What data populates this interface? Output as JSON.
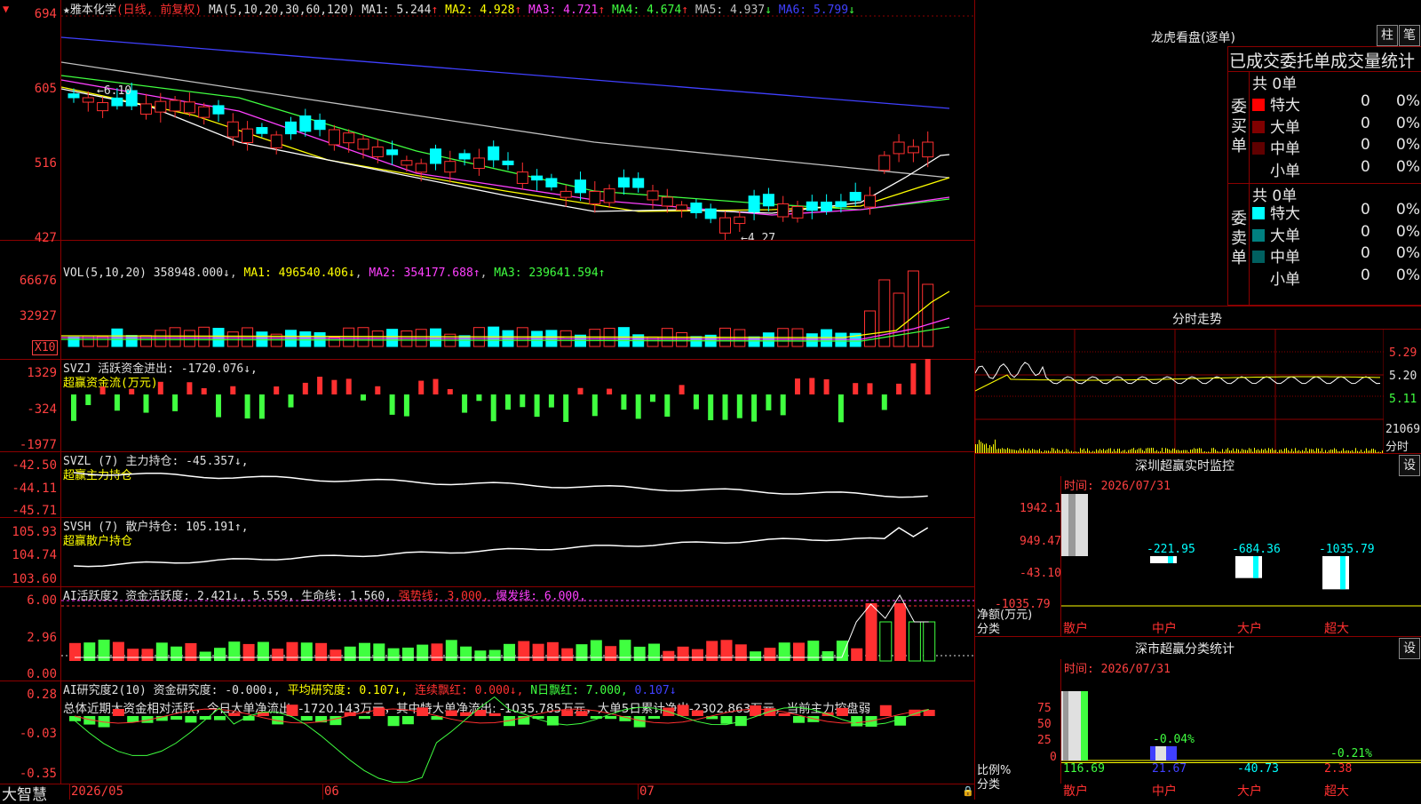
{
  "stock": {
    "star": "★",
    "name": "雅本化学",
    "period": "(日线, 前复权)",
    "ma_label": "MA(5,10,20,30,60,120)",
    "ma_values": [
      {
        "label": "MA1:",
        "value": "5.244",
        "arrow": "↑",
        "color": "#e0e0e0"
      },
      {
        "label": "MA2:",
        "value": "4.928",
        "arrow": "↑",
        "color": "#ffff00"
      },
      {
        "label": "MA3:",
        "value": "4.721",
        "arrow": "↑",
        "color": "#ff40ff"
      },
      {
        "label": "MA4:",
        "value": "4.674",
        "arrow": "↑",
        "color": "#40ff40"
      },
      {
        "label": "MA5:",
        "value": "4.937",
        "arrow": "↓",
        "color": "#c0c0c0"
      },
      {
        "label": "MA6:",
        "value": "5.799",
        "arrow": "↓",
        "color": "#4040ff"
      }
    ],
    "price_axis": [
      "694",
      "605",
      "516",
      "427"
    ],
    "high_mark": "←6.10",
    "low_mark": "←4.27"
  },
  "vol": {
    "title": "VOL(5,10,20)",
    "value": "358948.000↓",
    "ma1": "MA1: 496540.406↓",
    "ma2": "MA2: 354177.688↑",
    "ma3": "MA3: 239641.594↑",
    "axis": [
      "66676",
      "32927"
    ],
    "unit": "X10"
  },
  "svzj": {
    "title": "SVZJ  活跃资金进出: -1720.076↓,",
    "subtitle": "超赢资金流(万元)",
    "axis": [
      "1329",
      "-324",
      "-1977"
    ]
  },
  "svzl": {
    "title": "SVZL (7) 主力持仓: -45.357↓,",
    "subtitle": "超赢主力持仓",
    "axis": [
      "-42.50",
      "-44.11",
      "-45.71"
    ]
  },
  "svsh": {
    "title": "SVSH (7) 散户持仓: 105.191↑,",
    "subtitle": "超赢散户持仓",
    "axis": [
      "105.93",
      "104.74",
      "103.60"
    ]
  },
  "ai_active": {
    "title_a": "AI活跃度2 资金活跃度: 2.421↓, 5.559, 生命线: 1.560,",
    "title_b": " 强势线: 3.000,",
    "title_c": " 爆发线: 6.000,",
    "axis": [
      "6.00",
      "2.96",
      "0.00"
    ]
  },
  "ai_research": {
    "title_a": "AI研究度2(10) 资金研究度: -0.000↓,",
    "title_b": " 平均研究度: 0.107↓,",
    "title_c": " 连续飘红: 0.000↓,",
    "title_d": " N日飘红: 7.000,",
    "title_e": " 0.107↓",
    "summary": "总体近期大资金相对活跃，今日大单净流出: -1720.143万元，其中特大单净流出: -1035.785万元，大单5日累计净出-2302.863万元，当前主力控盘弱",
    "axis": [
      "0.28",
      "-0.03",
      "-0.35"
    ]
  },
  "bottom": {
    "brand": "大智慧",
    "dates": [
      "2026/05",
      "06",
      "07"
    ]
  },
  "dragon": {
    "title": "龙虎看盘(逐单)",
    "btn1": "柱",
    "btn2": "笔",
    "header": "已成交委托单成交量统计",
    "buy_label": "委买单",
    "sell_label": "委卖单",
    "buy_total": "共 0单",
    "sell_total": "共 0单",
    "rows": [
      {
        "name": "特大",
        "count": "0",
        "pct": "0%"
      },
      {
        "name": "大单",
        "count": "0",
        "pct": "0%"
      },
      {
        "name": "中单",
        "count": "0",
        "pct": "0%"
      },
      {
        "name": "小单",
        "count": "0",
        "pct": "0%"
      }
    ],
    "buy_colors": [
      "#ff0000",
      "#800000",
      "#600000",
      "#000000"
    ],
    "sell_colors": [
      "#00ffff",
      "#008080",
      "#006060",
      "#000000"
    ]
  },
  "intraday": {
    "title": "分时走势",
    "axis": [
      "5.29",
      "5.20",
      "5.11",
      "21069",
      "分时"
    ]
  },
  "sz_monitor": {
    "title": "深圳超赢实时监控",
    "btn": "设",
    "time": "时间: 2026/07/31",
    "axis": [
      "1942.1",
      "949.47",
      "-43.10",
      "-1035.79"
    ],
    "axis_label": "净额(万元)",
    "cat_label": "分类",
    "bars": [
      {
        "name": "散户",
        "value": 1942.1,
        "label": "1942.1"
      },
      {
        "name": "中户",
        "value": -221.95,
        "label": "-221.95"
      },
      {
        "name": "大户",
        "value": -684.36,
        "label": "-684.36"
      },
      {
        "name": "超大",
        "value": -1035.79,
        "label": "-1035.79"
      }
    ]
  },
  "sz_class": {
    "title": "深市超赢分类统计",
    "btn": "设",
    "time": "时间: 2026/07/31",
    "axis": [
      "75",
      "50",
      "25",
      "0"
    ],
    "axis_label": "比例%",
    "cat_label": "分类",
    "pct_mid": "-0.04%",
    "pct_right": "-0.21%",
    "cats": [
      {
        "name": "散户",
        "value": "116.69"
      },
      {
        "name": "中户",
        "value": "21.67"
      },
      {
        "name": "大户",
        "value": "-40.73"
      },
      {
        "name": "超大",
        "value": "2.38"
      }
    ]
  }
}
